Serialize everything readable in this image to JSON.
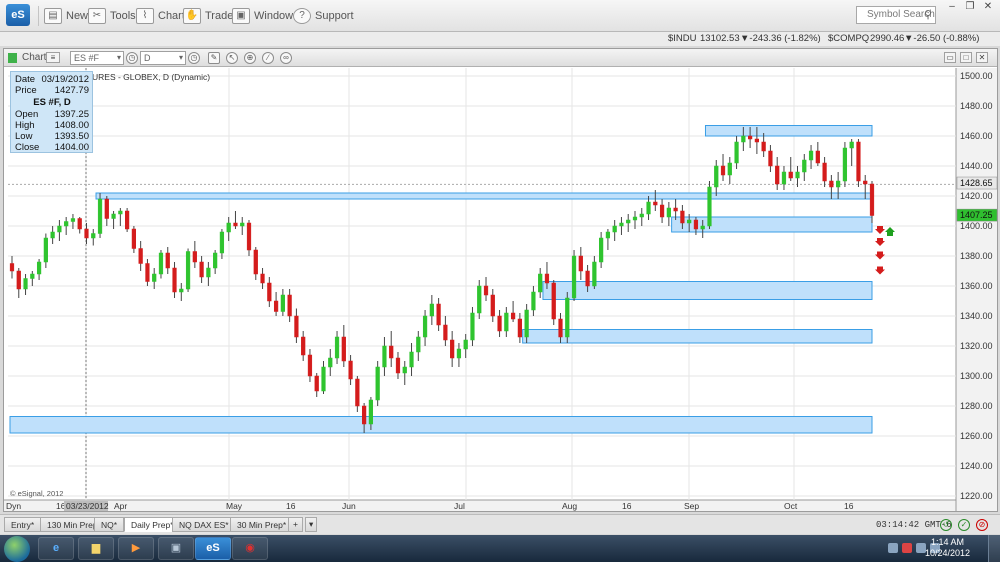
{
  "toolbar": {
    "logo": "eS",
    "items": [
      {
        "label": "New",
        "icon": "new-icon"
      },
      {
        "label": "Tools",
        "icon": "tools-icon"
      },
      {
        "label": "Chart",
        "icon": "chart-icon"
      },
      {
        "label": "Trade",
        "icon": "trade-icon"
      },
      {
        "label": "Windows",
        "icon": "windows-icon"
      },
      {
        "label": "Support",
        "icon": "help-icon"
      }
    ],
    "search_placeholder": "Symbol Search"
  },
  "ticker": {
    "indu_symbol": "$INDU",
    "indu_last": "13102.53",
    "indu_change": "▼-243.36 (-1.82%)",
    "compq_symbol": "$COMPQ",
    "compq_last": "2990.46",
    "compq_change": "▼-26.50 (-0.88%)"
  },
  "chart_window": {
    "title": "Chart",
    "symbol_field": "ES #F",
    "interval_field": "D",
    "chart_name": "URES - GLOBEX, D (Dynamic)",
    "copyright": "© eSignal, 2012"
  },
  "data_window": {
    "date_label": "Date",
    "date_value": "03/19/2012",
    "price_label": "Price",
    "price_value": "1427.79",
    "symbol": "ES #F, D",
    "open_label": "Open",
    "open_value": "1397.25",
    "high_label": "High",
    "high_value": "1408.00",
    "low_label": "Low",
    "low_value": "1393.50",
    "close_label": "Close",
    "close_value": "1404.00"
  },
  "chart_data": {
    "type": "candlestick",
    "y_ticks": [
      1220,
      1240,
      1260,
      1280,
      1300,
      1320,
      1340,
      1360,
      1380,
      1400,
      1420,
      1440,
      1460,
      1480,
      1500
    ],
    "ylim": [
      1220,
      1500
    ],
    "x_labels": [
      "Dyn",
      "16",
      "03/23/2012",
      "Apr",
      "May",
      "16",
      "Jun",
      "Jul",
      "Aug",
      "16",
      "Sep",
      "Oct",
      "16"
    ],
    "price_tags": [
      {
        "value": 1428.65,
        "label": "1428.65",
        "color": "#e8e8e8"
      },
      {
        "value": 1407.25,
        "label": "1407.25",
        "color": "#2fbf2f"
      }
    ],
    "zones": [
      {
        "from": 1460,
        "to": 1467
      },
      {
        "from": 1418,
        "to": 1422
      },
      {
        "from": 1396,
        "to": 1406
      },
      {
        "from": 1351,
        "to": 1363
      },
      {
        "from": 1322,
        "to": 1331
      },
      {
        "from": 1262,
        "to": 1273
      }
    ],
    "candles": [
      [
        1375,
        1380,
        1365,
        1370
      ],
      [
        1370,
        1372,
        1352,
        1358
      ],
      [
        1358,
        1368,
        1354,
        1365
      ],
      [
        1365,
        1370,
        1360,
        1368
      ],
      [
        1368,
        1378,
        1364,
        1376
      ],
      [
        1376,
        1395,
        1372,
        1392
      ],
      [
        1392,
        1400,
        1388,
        1396
      ],
      [
        1396,
        1404,
        1390,
        1400
      ],
      [
        1400,
        1406,
        1394,
        1403
      ],
      [
        1403,
        1408,
        1398,
        1405
      ],
      [
        1405,
        1406,
        1395,
        1398
      ],
      [
        1398,
        1402,
        1388,
        1392
      ],
      [
        1392,
        1398,
        1387,
        1395
      ],
      [
        1395,
        1422,
        1392,
        1418
      ],
      [
        1418,
        1420,
        1400,
        1405
      ],
      [
        1405,
        1410,
        1398,
        1408
      ],
      [
        1408,
        1412,
        1400,
        1410
      ],
      [
        1410,
        1412,
        1396,
        1398
      ],
      [
        1398,
        1400,
        1382,
        1385
      ],
      [
        1385,
        1390,
        1370,
        1375
      ],
      [
        1375,
        1378,
        1360,
        1363
      ],
      [
        1363,
        1372,
        1358,
        1368
      ],
      [
        1368,
        1384,
        1365,
        1382
      ],
      [
        1382,
        1386,
        1368,
        1372
      ],
      [
        1372,
        1376,
        1352,
        1356
      ],
      [
        1356,
        1362,
        1350,
        1358
      ],
      [
        1358,
        1385,
        1356,
        1383
      ],
      [
        1383,
        1390,
        1372,
        1376
      ],
      [
        1376,
        1380,
        1362,
        1366
      ],
      [
        1366,
        1376,
        1360,
        1372
      ],
      [
        1372,
        1384,
        1368,
        1382
      ],
      [
        1382,
        1398,
        1378,
        1396
      ],
      [
        1396,
        1406,
        1390,
        1402
      ],
      [
        1402,
        1410,
        1398,
        1400
      ],
      [
        1400,
        1406,
        1394,
        1402
      ],
      [
        1402,
        1404,
        1380,
        1384
      ],
      [
        1384,
        1386,
        1364,
        1368
      ],
      [
        1368,
        1372,
        1358,
        1362
      ],
      [
        1362,
        1366,
        1346,
        1350
      ],
      [
        1350,
        1356,
        1340,
        1343
      ],
      [
        1343,
        1358,
        1340,
        1354
      ],
      [
        1354,
        1358,
        1336,
        1340
      ],
      [
        1340,
        1345,
        1322,
        1326
      ],
      [
        1326,
        1330,
        1310,
        1314
      ],
      [
        1314,
        1318,
        1296,
        1300
      ],
      [
        1300,
        1302,
        1286,
        1290
      ],
      [
        1290,
        1310,
        1288,
        1306
      ],
      [
        1306,
        1318,
        1300,
        1312
      ],
      [
        1312,
        1330,
        1308,
        1326
      ],
      [
        1326,
        1334,
        1306,
        1310
      ],
      [
        1310,
        1314,
        1294,
        1298
      ],
      [
        1298,
        1300,
        1276,
        1280
      ],
      [
        1280,
        1282,
        1262,
        1268
      ],
      [
        1268,
        1286,
        1264,
        1284
      ],
      [
        1284,
        1310,
        1280,
        1306
      ],
      [
        1306,
        1326,
        1300,
        1320
      ],
      [
        1320,
        1330,
        1306,
        1312
      ],
      [
        1312,
        1316,
        1298,
        1302
      ],
      [
        1302,
        1310,
        1294,
        1306
      ],
      [
        1306,
        1322,
        1300,
        1316
      ],
      [
        1316,
        1330,
        1310,
        1326
      ],
      [
        1326,
        1344,
        1320,
        1340
      ],
      [
        1340,
        1354,
        1334,
        1348
      ],
      [
        1348,
        1352,
        1330,
        1334
      ],
      [
        1334,
        1340,
        1320,
        1324
      ],
      [
        1324,
        1330,
        1306,
        1312
      ],
      [
        1312,
        1322,
        1306,
        1318
      ],
      [
        1318,
        1328,
        1312,
        1324
      ],
      [
        1324,
        1346,
        1320,
        1342
      ],
      [
        1342,
        1364,
        1338,
        1360
      ],
      [
        1360,
        1366,
        1350,
        1354
      ],
      [
        1354,
        1358,
        1336,
        1340
      ],
      [
        1340,
        1344,
        1326,
        1330
      ],
      [
        1330,
        1346,
        1326,
        1342
      ],
      [
        1342,
        1350,
        1336,
        1338
      ],
      [
        1338,
        1342,
        1322,
        1326
      ],
      [
        1326,
        1348,
        1322,
        1344
      ],
      [
        1344,
        1360,
        1340,
        1356
      ],
      [
        1356,
        1372,
        1352,
        1368
      ],
      [
        1368,
        1376,
        1358,
        1362
      ],
      [
        1362,
        1364,
        1334,
        1338
      ],
      [
        1338,
        1342,
        1322,
        1326
      ],
      [
        1326,
        1356,
        1322,
        1352
      ],
      [
        1352,
        1384,
        1350,
        1380
      ],
      [
        1380,
        1386,
        1364,
        1370
      ],
      [
        1370,
        1374,
        1356,
        1360
      ],
      [
        1360,
        1380,
        1358,
        1376
      ],
      [
        1376,
        1396,
        1372,
        1392
      ],
      [
        1392,
        1398,
        1384,
        1396
      ],
      [
        1396,
        1404,
        1390,
        1400
      ],
      [
        1400,
        1406,
        1394,
        1402
      ],
      [
        1402,
        1408,
        1396,
        1404
      ],
      [
        1404,
        1410,
        1398,
        1406
      ],
      [
        1406,
        1412,
        1400,
        1408
      ],
      [
        1408,
        1420,
        1404,
        1416
      ],
      [
        1416,
        1424,
        1410,
        1414
      ],
      [
        1414,
        1418,
        1402,
        1406
      ],
      [
        1406,
        1416,
        1400,
        1412
      ],
      [
        1412,
        1418,
        1404,
        1410
      ],
      [
        1410,
        1414,
        1398,
        1402
      ],
      [
        1402,
        1408,
        1396,
        1404
      ],
      [
        1404,
        1406,
        1394,
        1398
      ],
      [
        1398,
        1404,
        1392,
        1400
      ],
      [
        1400,
        1430,
        1398,
        1426
      ],
      [
        1426,
        1444,
        1420,
        1440
      ],
      [
        1440,
        1448,
        1430,
        1434
      ],
      [
        1434,
        1446,
        1428,
        1442
      ],
      [
        1442,
        1460,
        1438,
        1456
      ],
      [
        1456,
        1466,
        1450,
        1460
      ],
      [
        1460,
        1466,
        1452,
        1458
      ],
      [
        1458,
        1466,
        1448,
        1456
      ],
      [
        1456,
        1462,
        1446,
        1450
      ],
      [
        1450,
        1454,
        1436,
        1440
      ],
      [
        1440,
        1446,
        1424,
        1428
      ],
      [
        1428,
        1440,
        1424,
        1436
      ],
      [
        1436,
        1446,
        1430,
        1432
      ],
      [
        1432,
        1440,
        1426,
        1436
      ],
      [
        1436,
        1448,
        1430,
        1444
      ],
      [
        1444,
        1454,
        1438,
        1450
      ],
      [
        1450,
        1456,
        1440,
        1442
      ],
      [
        1442,
        1446,
        1426,
        1430
      ],
      [
        1430,
        1434,
        1418,
        1426
      ],
      [
        1426,
        1436,
        1418,
        1430
      ],
      [
        1430,
        1456,
        1426,
        1452
      ],
      [
        1452,
        1458,
        1440,
        1456
      ],
      [
        1456,
        1458,
        1426,
        1430
      ],
      [
        1430,
        1434,
        1418,
        1428
      ],
      [
        1428,
        1430,
        1402,
        1407
      ]
    ],
    "up_color": "#2fc42f",
    "down_color": "#d41c1c"
  },
  "tabs": [
    "Entry*",
    "130 Min Prep",
    "NQ*",
    "Daily Prep*",
    "NQ DAX ES*",
    "30 Min Prep*"
  ],
  "status_clock": "03:14:42 GMT-6",
  "taskbar": {
    "time": "1:14 AM",
    "date": "10/24/2012",
    "esignal_label": "eS"
  }
}
